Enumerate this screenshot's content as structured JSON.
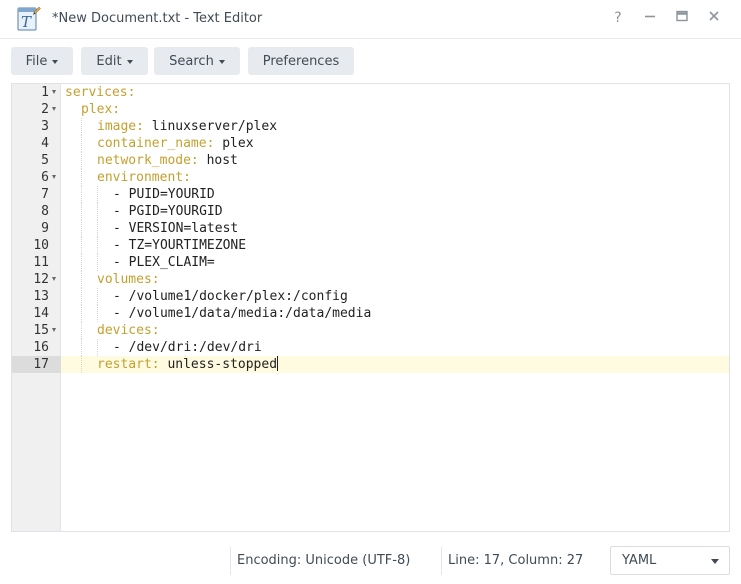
{
  "window": {
    "title": "*New Document.txt - Text Editor",
    "app_icon": "text-editor-app-icon",
    "controls": {
      "help": "?",
      "minimize": "—",
      "maximize": "▣",
      "close": "✕"
    }
  },
  "toolbar": {
    "file_label": "File",
    "edit_label": "Edit",
    "search_label": "Search",
    "preferences_label": "Preferences"
  },
  "editor": {
    "active_line": 17,
    "lines": [
      {
        "n": "1",
        "indent": 0,
        "key": "services:",
        "val": "",
        "fold": true
      },
      {
        "n": "2",
        "indent": 1,
        "key": "plex:",
        "val": "",
        "fold": true
      },
      {
        "n": "3",
        "indent": 2,
        "key": "image:",
        "val": " linuxserver/plex",
        "fold": false
      },
      {
        "n": "4",
        "indent": 2,
        "key": "container_name:",
        "val": " plex",
        "fold": false
      },
      {
        "n": "5",
        "indent": 2,
        "key": "network_mode:",
        "val": " host",
        "fold": false
      },
      {
        "n": "6",
        "indent": 2,
        "key": "environment:",
        "val": "",
        "fold": true
      },
      {
        "n": "7",
        "indent": 3,
        "key": "",
        "val": "- PUID=YOURID",
        "fold": false
      },
      {
        "n": "8",
        "indent": 3,
        "key": "",
        "val": "- PGID=YOURGID",
        "fold": false
      },
      {
        "n": "9",
        "indent": 3,
        "key": "",
        "val": "- VERSION=latest",
        "fold": false
      },
      {
        "n": "10",
        "indent": 3,
        "key": "",
        "val": "- TZ=YOURTIMEZONE",
        "fold": false
      },
      {
        "n": "11",
        "indent": 3,
        "key": "",
        "val": "- PLEX_CLAIM=",
        "fold": false
      },
      {
        "n": "12",
        "indent": 2,
        "key": "volumes:",
        "val": "",
        "fold": true
      },
      {
        "n": "13",
        "indent": 3,
        "key": "",
        "val": "- /volume1/docker/plex:/config",
        "fold": false
      },
      {
        "n": "14",
        "indent": 3,
        "key": "",
        "val": "- /volume1/data/media:/data/media",
        "fold": false
      },
      {
        "n": "15",
        "indent": 2,
        "key": "devices:",
        "val": "",
        "fold": true
      },
      {
        "n": "16",
        "indent": 3,
        "key": "",
        "val": "- /dev/dri:/dev/dri",
        "fold": false
      },
      {
        "n": "17",
        "indent": 2,
        "key": "restart:",
        "val": " unless-stopped",
        "fold": false
      }
    ]
  },
  "status": {
    "encoding": "Encoding: Unicode (UTF-8)",
    "position": "Line: 17, Column: 27",
    "language": "YAML"
  },
  "colors": {
    "yaml_key": "#c5a030",
    "active_line": "#fefbe0",
    "gutter": "#f0f0f0",
    "button_bg": "#e7ebef"
  }
}
